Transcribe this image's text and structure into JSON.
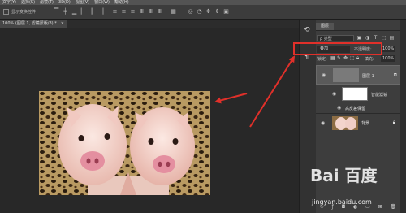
{
  "menubar": {
    "items": [
      "文字(Y)",
      "选择(S)",
      "滤镜(T)",
      "3D(D)",
      "视图(V)",
      "窗口(W)",
      "帮助(H)"
    ]
  },
  "options": {
    "transform_label": "显示变换控件"
  },
  "document": {
    "tab_title": "100% (图层 1, 滤镜蒙版/8) *",
    "close": "×"
  },
  "layers_panel": {
    "tab": "图层",
    "filter_kind": "类型",
    "blend_mode": "叠加",
    "opacity_label": "不透明度:",
    "opacity_value": "100%",
    "lock_label": "锁定:",
    "fill_label": "填充:",
    "fill_value": "100%",
    "layers": [
      {
        "name": "图层 1"
      },
      {
        "name": "智能滤镜"
      },
      {
        "name": "高反差保留"
      },
      {
        "name": "背景"
      }
    ]
  },
  "watermark": {
    "logo": "Bai 百度",
    "url": "jingyan.baidu.com"
  },
  "colors": {
    "highlight": "#e0302a",
    "panel": "#3d3d3d",
    "canvas": "#282828"
  }
}
